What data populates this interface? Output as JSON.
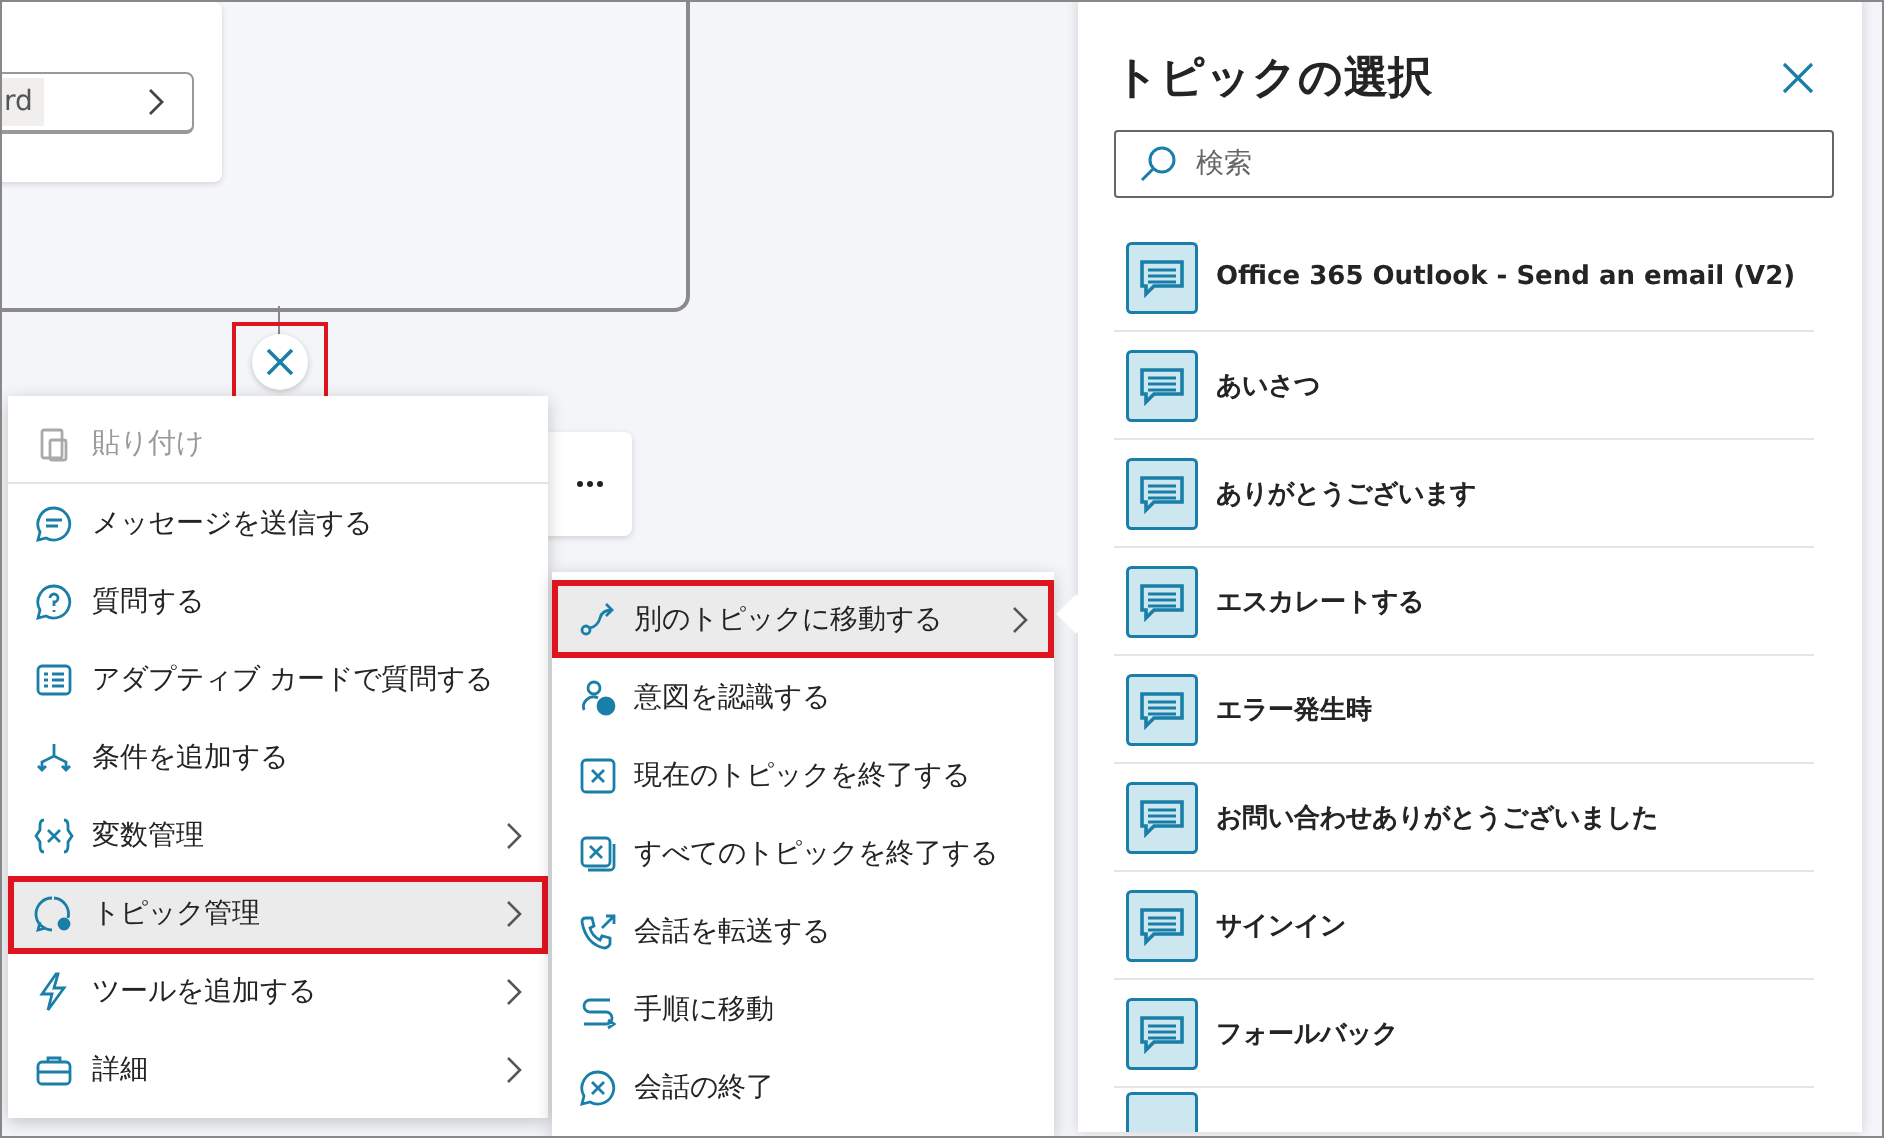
{
  "canvas": {
    "node_field": {
      "tag": "rd"
    },
    "add_button": {
      "highlighted": true
    }
  },
  "main_menu": {
    "items": [
      {
        "label": "貼り付け",
        "disabled": true,
        "submenu": false,
        "selected": false,
        "highlighted": false
      },
      {
        "label": "メッセージを送信する",
        "disabled": false,
        "submenu": false,
        "selected": false,
        "highlighted": false
      },
      {
        "label": "質問する",
        "disabled": false,
        "submenu": false,
        "selected": false,
        "highlighted": false
      },
      {
        "label": "アダプティブ カードで質問する",
        "disabled": false,
        "submenu": false,
        "selected": false,
        "highlighted": false
      },
      {
        "label": "条件を追加する",
        "disabled": false,
        "submenu": false,
        "selected": false,
        "highlighted": false
      },
      {
        "label": "変数管理",
        "disabled": false,
        "submenu": true,
        "selected": false,
        "highlighted": false
      },
      {
        "label": "トピック管理",
        "disabled": false,
        "submenu": true,
        "selected": true,
        "highlighted": true
      },
      {
        "label": "ツールを追加する",
        "disabled": false,
        "submenu": true,
        "selected": false,
        "highlighted": false
      },
      {
        "label": "詳細",
        "disabled": false,
        "submenu": true,
        "selected": false,
        "highlighted": false
      }
    ]
  },
  "sub_menu": {
    "items": [
      {
        "label": "別のトピックに移動する",
        "submenu": true,
        "selected": true,
        "highlighted": true
      },
      {
        "label": "意図を認識する",
        "submenu": false,
        "selected": false,
        "highlighted": false
      },
      {
        "label": "現在のトピックを終了する",
        "submenu": false,
        "selected": false,
        "highlighted": false
      },
      {
        "label": "すべてのトピックを終了する",
        "submenu": false,
        "selected": false,
        "highlighted": false
      },
      {
        "label": "会話を転送する",
        "submenu": false,
        "selected": false,
        "highlighted": false
      },
      {
        "label": "手順に移動",
        "submenu": false,
        "selected": false,
        "highlighted": false
      },
      {
        "label": "会話の終了",
        "submenu": false,
        "selected": false,
        "highlighted": false
      }
    ]
  },
  "topic_panel": {
    "title": "トピックの選択",
    "search": {
      "placeholder": "検索"
    },
    "topics": [
      {
        "label": "Office 365 Outlook - Send an email (V2)"
      },
      {
        "label": "あいさつ"
      },
      {
        "label": "ありがとうございます"
      },
      {
        "label": "エスカレートする"
      },
      {
        "label": "エラー発生時"
      },
      {
        "label": "お問い合わせありがとうございました"
      },
      {
        "label": "サインイン"
      },
      {
        "label": "フォールバック"
      }
    ]
  }
}
